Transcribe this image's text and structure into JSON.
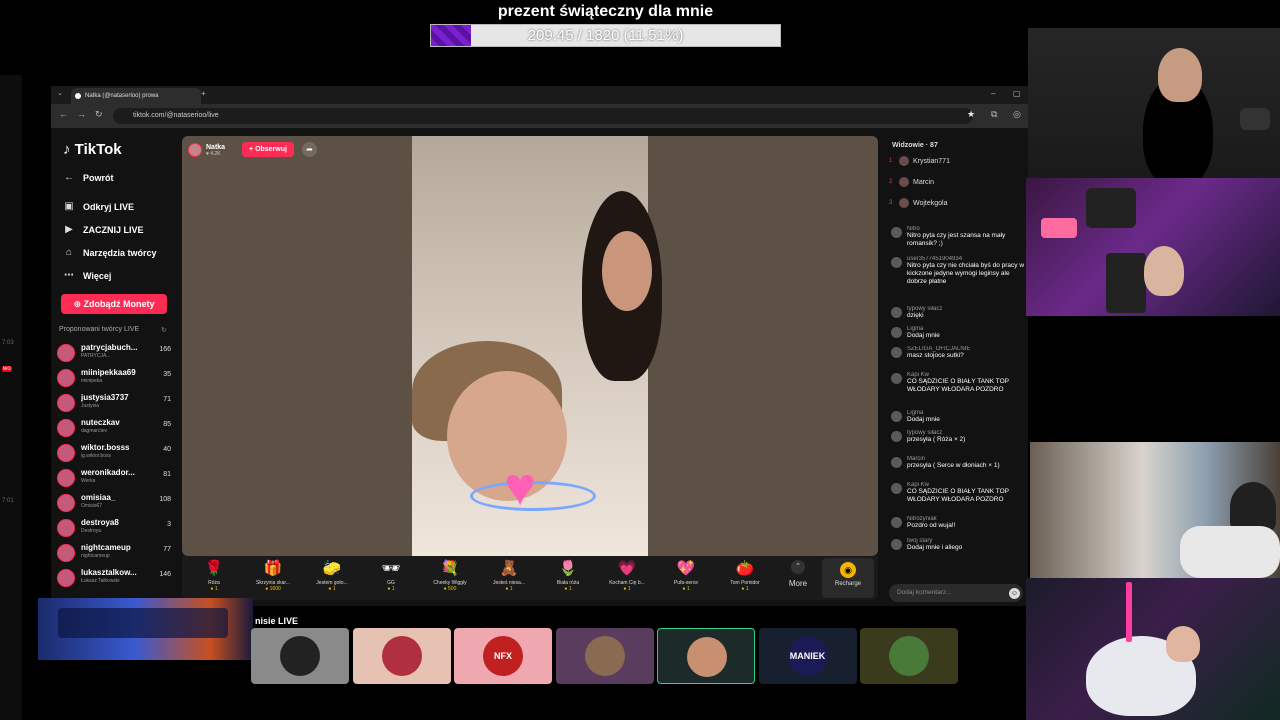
{
  "overlay": {
    "goal_title": "prezent świąteczny dla mnie",
    "goal_text": "209.45 / 1820 (11.51%)",
    "goal_fraction": 0.1151
  },
  "browser": {
    "tab_title": "Natka (@nataserioo) prowa",
    "url": "tiktok.com/@nataserioo/live"
  },
  "tiktok": {
    "logo": "TikTok",
    "nav": [
      "Powrót",
      "Odkryj LIVE",
      "ZACZNIJ LIVE",
      "Narzędzia twórcy",
      "Więcej"
    ],
    "coins_button": "Zdobądź Monety",
    "suggested_title": "Proponowani twórcy LIVE",
    "creators": [
      {
        "name": "patrycjabuch...",
        "sub": "PATRYCJA...",
        "count": "166"
      },
      {
        "name": "miinipekkaa69",
        "sub": "miinipeka",
        "count": "35"
      },
      {
        "name": "justysia3737",
        "sub": "Justysia",
        "count": "71"
      },
      {
        "name": "nuteczkav",
        "sub": "dagmarctev",
        "count": "85"
      },
      {
        "name": "wiktor.bosss",
        "sub": "ig.wiktor.boss",
        "count": "40"
      },
      {
        "name": "weronikador...",
        "sub": "Werka",
        "count": "81"
      },
      {
        "name": "omisiaa_",
        "sub": "Omisio67",
        "count": "108"
      },
      {
        "name": "destroya8",
        "sub": "Destroya",
        "count": "3"
      },
      {
        "name": "nightcameup",
        "sub": "nightcameup",
        "count": "77"
      },
      {
        "name": "lukasztalkow...",
        "sub": "Łukasz Talkowski",
        "count": "146"
      }
    ]
  },
  "stream": {
    "streamer_name": "Natka",
    "streamer_likes": "4.2K",
    "follow_label": "+ Obserwuj"
  },
  "gifts": [
    {
      "icon": "🌹",
      "name": "Róża",
      "price": "1"
    },
    {
      "icon": "🎁",
      "name": "Skrzynia skar...",
      "price": "1600"
    },
    {
      "icon": "🧽",
      "name": "Jestem goto...",
      "price": "1"
    },
    {
      "icon": "🕶",
      "name": "GG",
      "price": "1"
    },
    {
      "icon": "💐",
      "name": "Cheeky Wiggly",
      "price": "500"
    },
    {
      "icon": "🧸",
      "name": "Jesteś niesa...",
      "price": "1"
    },
    {
      "icon": "🌷",
      "name": "Biała róża",
      "price": "1"
    },
    {
      "icon": "💗",
      "name": "Kocham Cię b...",
      "price": "1"
    },
    {
      "icon": "💖",
      "name": "Pufa-serce",
      "price": "1"
    },
    {
      "icon": "🍅",
      "name": "Tom Pomidor",
      "price": "1"
    }
  ],
  "gift_more": "More",
  "recharge_label": "Recharge",
  "chat": {
    "viewers_title": "Widzowie · 87",
    "top_viewers": [
      {
        "rank": "1",
        "name": "Krystian771"
      },
      {
        "rank": "2",
        "name": "Marcin"
      },
      {
        "rank": "3",
        "name": "Wojtekgola"
      }
    ],
    "messages": [
      {
        "user": "Nitro",
        "text": "Nitro pyta czy jest szansa na mały romansik? ;)"
      },
      {
        "user": "user3577451904934",
        "text": "Nitro pyta czy nie chciała byś do pracy w kickzone jedyne wymogi leginsy ale dobrze płatne"
      },
      {
        "user": "typowy siłacz",
        "text": "dzięki"
      },
      {
        "user": "Ligma",
        "text": "Dodaj mnie"
      },
      {
        "user": "SZELIGA_OFICJALNIE",
        "text": "masz stojoce sutki?"
      },
      {
        "user": "Kapi Kw",
        "text": "CO SĄDZICIE O BIAŁY TANK TOP WŁODARY WŁODARA POZDRO"
      },
      {
        "user": "Ligma",
        "text": "Dodaj mnie"
      },
      {
        "user": "typowy siłacz",
        "text": "przesyła ( Róża × 2)"
      },
      {
        "user": "Marcin",
        "text": "przesyła ( Serce w dłoniach × 1)"
      },
      {
        "user": "Kapi Kw",
        "text": "CO SĄDZICIE O BIAŁY TANK TOP WŁODARY WŁODARA POZDRO"
      },
      {
        "user": "Nitrozyniak",
        "text": "Pozdro od wuja!!"
      },
      {
        "user": "twoj stary",
        "text": "Dodaj mnie i aliego"
      }
    ],
    "input_placeholder": "Dodaj komentarz..."
  },
  "suggested_lives_label": "nisie LIVE",
  "suggested_thumbs": [
    "",
    "",
    "",
    "NFX",
    "",
    "",
    "MANIEK",
    ""
  ],
  "left_strip_marks": [
    "7:03",
    "wo",
    "7:01"
  ]
}
